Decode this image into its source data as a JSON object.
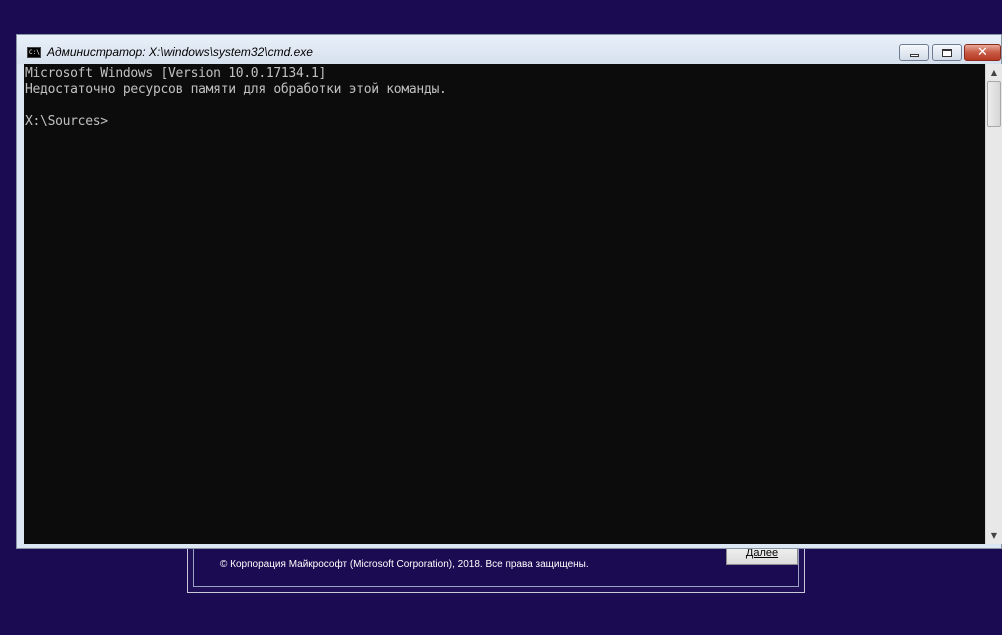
{
  "background_setup": {
    "copyright": "© Корпорация Майкрософт (Microsoft Corporation), 2018. Все права защищены.",
    "next_button": "Далее"
  },
  "window": {
    "title": "Администратор: X:\\windows\\system32\\cmd.exe",
    "icon": "cmd-icon",
    "close_glyph": "✕"
  },
  "console": {
    "lines": [
      "Microsoft Windows [Version 10.0.17134.1]",
      "Недостаточно ресурсов памяти для обработки этой команды.",
      "",
      "X:\\Sources>"
    ]
  },
  "scrollbar": {
    "up_arrow": "▲",
    "down_arrow": "▼"
  },
  "colors": {
    "desktop": "#1b0b52",
    "console_bg": "#0c0c0c",
    "console_fg": "#c0c0c0"
  }
}
